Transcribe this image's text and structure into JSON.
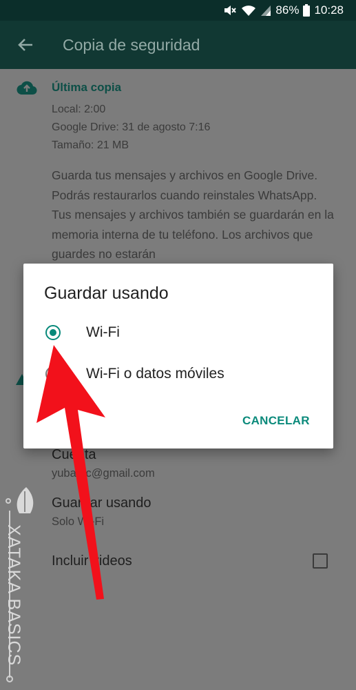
{
  "status_bar": {
    "battery": "86%",
    "time": "10:28"
  },
  "app_bar": {
    "title": "Copia de seguridad"
  },
  "last_backup": {
    "title": "Última copia",
    "local": "Local: 2:00",
    "google_drive": "Google Drive: 31 de agosto 7:16",
    "size": "Tamaño: 21 MB",
    "description": "Guarda tus mensajes y archivos en Google Drive. Podrás restaurarlos cuando reinstales WhatsApp. Tus mensajes y archivos también se guardarán en la memoria interna de tu teléfono. Los archivos que guardes no estarán"
  },
  "settings": {
    "account_label": "Cuenta",
    "account_value": "yubatec@gmail.com",
    "save_using_label": "Guardar usando",
    "save_using_value": "Solo Wi-Fi",
    "include_videos_label": "Incluir videos"
  },
  "dialog": {
    "title": "Guardar usando",
    "options": [
      {
        "label": "Wi-Fi",
        "selected": true
      },
      {
        "label": "Wi-Fi o datos móviles",
        "selected": false
      }
    ],
    "cancel_label": "CANCELAR"
  },
  "watermark": {
    "text": "XATAKA BASICS"
  },
  "colors": {
    "accent": "#07897a",
    "appbar": "#113833",
    "arrow": "#f2111b"
  }
}
